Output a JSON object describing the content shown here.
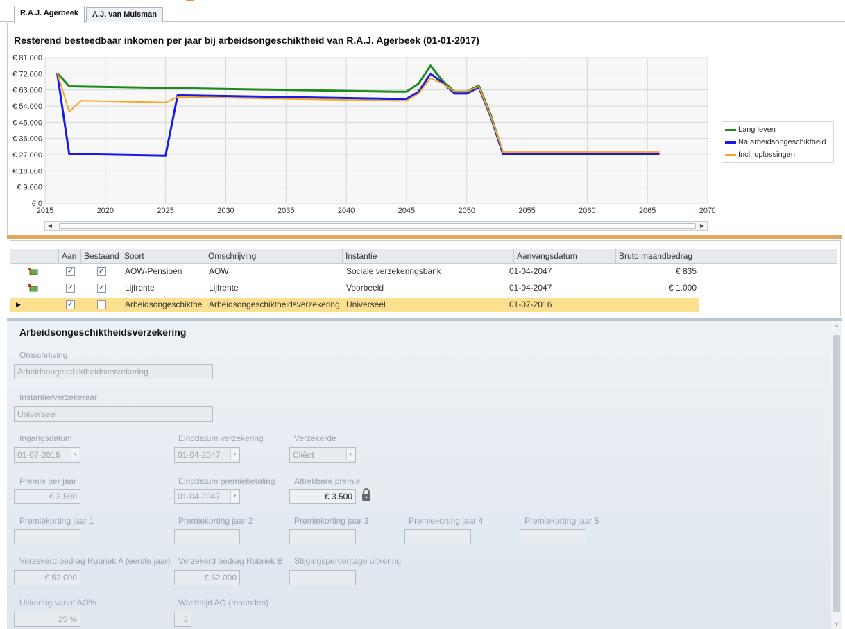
{
  "tabs": [
    {
      "label": "R.A.J. Agerbeek",
      "active": true
    },
    {
      "label": "A.J. van Muisman",
      "active": false
    }
  ],
  "chart_data": {
    "type": "line",
    "title": "Resterend besteedbaar inkomen per jaar bij arbeidsongeschiktheid van R.A.J. Agerbeek (01-01-2017)",
    "xlabel": "",
    "ylabel": "",
    "xlim": [
      2015,
      2070
    ],
    "ylim": [
      0,
      81000
    ],
    "x_ticks": [
      2015,
      2020,
      2025,
      2030,
      2035,
      2040,
      2045,
      2050,
      2055,
      2060,
      2065,
      2070
    ],
    "y_ticks": [
      0,
      9000,
      18000,
      27000,
      36000,
      45000,
      54000,
      63000,
      72000,
      81000
    ],
    "y_tick_labels": [
      "€ 0",
      "€ 9.000",
      "€ 18.000",
      "€ 27.000",
      "€ 36.000",
      "€ 45.000",
      "€ 54.000",
      "€ 63.000",
      "€ 72.000",
      "€ 81.000"
    ],
    "grid": true,
    "legend_position": "right",
    "series": [
      {
        "name": "Lang leven",
        "color": "#1e8a1e",
        "x": [
          2016,
          2017,
          2026,
          2044,
          2045,
          2046,
          2047,
          2048,
          2049,
          2050,
          2051,
          2052,
          2053,
          2066
        ],
        "y": [
          72500,
          65000,
          64000,
          62000,
          62000,
          66500,
          76500,
          68000,
          62000,
          62000,
          65500,
          49000,
          28000,
          28000
        ]
      },
      {
        "name": "Na arbeidsongeschiktheid",
        "color": "#1a1ae6",
        "x": [
          2016,
          2017,
          2025,
          2026,
          2044,
          2045,
          2046,
          2047,
          2048,
          2049,
          2050,
          2051,
          2052,
          2053,
          2066
        ],
        "y": [
          72500,
          27500,
          26500,
          60000,
          58000,
          58000,
          62000,
          72000,
          67000,
          61000,
          61000,
          64500,
          48000,
          27500,
          27500
        ]
      },
      {
        "name": "Incl. oplossingen",
        "color": "#f5a623",
        "x": [
          2016,
          2017,
          2018,
          2025,
          2026,
          2044,
          2045,
          2046,
          2047,
          2048,
          2049,
          2050,
          2051,
          2052,
          2053,
          2066
        ],
        "y": [
          72500,
          51000,
          57000,
          56000,
          59000,
          57000,
          57000,
          61000,
          69500,
          66500,
          62000,
          62000,
          65000,
          48500,
          28500,
          28500
        ]
      }
    ]
  },
  "grid": {
    "headers": [
      "Aan",
      "Bestaand",
      "Soort",
      "Omschrijving",
      "Instantie",
      "Aanvangsdatum",
      "Bruto maandbedrag"
    ],
    "rows": [
      {
        "aan": true,
        "bestaand": true,
        "soort": "AOW-Pensioen",
        "omschrijving": "AOW",
        "instantie": "Sociale verzekeringsbank",
        "aanvangsdatum": "01-04-2047",
        "bedrag": "€ 835",
        "selected": false
      },
      {
        "aan": true,
        "bestaand": true,
        "soort": "Lijfrente",
        "omschrijving": "Lijfrente",
        "instantie": "Voorbeeld",
        "aanvangsdatum": "01-04-2047",
        "bedrag": "€ 1.000",
        "selected": false
      },
      {
        "aan": true,
        "bestaand": false,
        "soort": "Arbeidsongeschikthe",
        "omschrijving": "Arbeidsongeschiktheidsverzekering",
        "instantie": "Universeel",
        "aanvangsdatum": "01-07-2016",
        "bedrag": "",
        "selected": true
      }
    ]
  },
  "detail": {
    "title": "Arbeidsongeschiktheidsverzekering",
    "omschrijving_label": "Omschrijving",
    "omschrijving_value": "Arbeidsongeschiktheidsverzekering",
    "instantie_label": "Instantie/verzekeraar",
    "instantie_value": "Universeel",
    "ingangsdatum_label": "Ingangsdatum",
    "ingangsdatum_value": "01-07-2016",
    "einddatum_verz_label": "Einddatum verzekering",
    "einddatum_verz_value": "01-04-2047",
    "verzekerde_label": "Verzekerde",
    "verzekerde_value": "Cliënt",
    "premie_label": "Premie per jaar",
    "premie_value": "€ 3.500",
    "einddatum_premie_label": "Einddatum premiebetaling",
    "einddatum_premie_value": "01-04-2047",
    "aftrekbare_label": "Aftrekbare premie",
    "aftrekbare_value": "€ 3.500",
    "korting1_label": "Premiekorting jaar 1",
    "korting2_label": "Premiekorting jaar 2",
    "korting3_label": "Premiekorting jaar 3",
    "korting4_label": "Premiekorting jaar 4",
    "korting5_label": "Premiekorting jaar 5",
    "rubriek_a_label": "Verzekerd bedrag Rubriek A (eerste jaar)",
    "rubriek_a_value": "€ 52.000",
    "rubriek_b_label": "Verzekerd bedrag Rubriek B",
    "rubriek_b_value": "€ 52.000",
    "stijging_label": "Stijgingspercentage uitkering",
    "uitkering_label": "Uitkering vanaf AO%",
    "uitkering_value": "25 %",
    "wachttijd_label": "Wachttijd AO (maanden)",
    "wachttijd_value": "3"
  }
}
